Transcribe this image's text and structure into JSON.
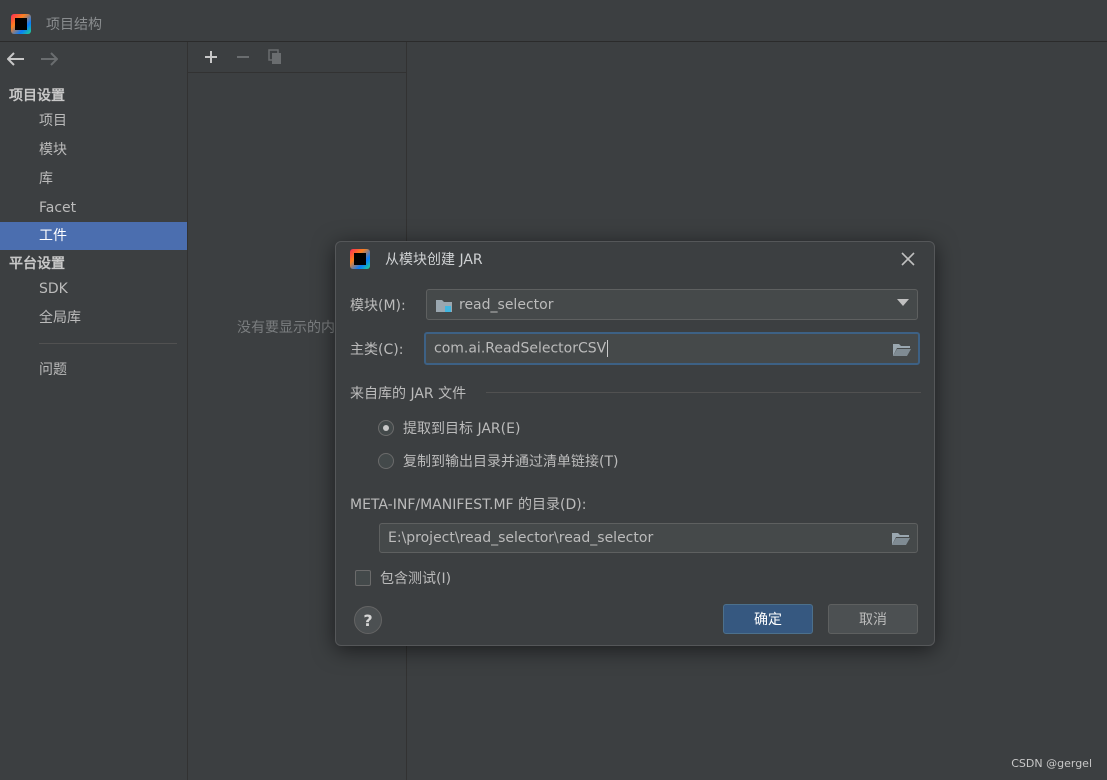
{
  "window": {
    "title": "项目结构"
  },
  "sidebar": {
    "items": [
      {
        "label": "项目设置",
        "kind": "section"
      },
      {
        "label": "项目",
        "kind": "child"
      },
      {
        "label": "模块",
        "kind": "child"
      },
      {
        "label": "库",
        "kind": "child"
      },
      {
        "label": "Facet",
        "kind": "child"
      },
      {
        "label": "工件",
        "kind": "child",
        "selected": true
      },
      {
        "label": "平台设置",
        "kind": "section"
      },
      {
        "label": "SDK",
        "kind": "child"
      },
      {
        "label": "全局库",
        "kind": "child"
      },
      {
        "label": "问题",
        "kind": "child"
      }
    ]
  },
  "empty_panel": {
    "text": "没有要显示的内"
  },
  "dialog": {
    "title": "从模块创建 JAR",
    "module": {
      "label": "模块(M):",
      "value": "read_selector"
    },
    "main_class": {
      "label": "主类(C):",
      "value": "com.ai.ReadSelectorCSV"
    },
    "jar_group": {
      "label": "来自库的 JAR 文件",
      "options": [
        {
          "label": "提取到目标 JAR(E)",
          "checked": true
        },
        {
          "label": "复制到输出目录并通过清单链接(T)",
          "checked": false
        }
      ]
    },
    "manifest": {
      "label": "META-INF/MANIFEST.MF 的目录(D):",
      "value": "E:\\project\\read_selector\\read_selector"
    },
    "include_tests": {
      "label": "包含测试(I)",
      "checked": false
    },
    "help_label": "?",
    "ok_label": "确定",
    "cancel_label": "取消"
  },
  "watermark": "CSDN @gergel",
  "colors": {
    "background": "#3c3f41",
    "selection": "#4b6eaf",
    "primary_button": "#365880",
    "focus_border": "#3d6185"
  }
}
